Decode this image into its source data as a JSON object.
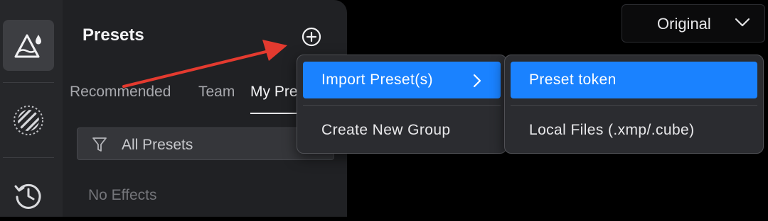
{
  "panel": {
    "title": "Presets",
    "tabs": [
      {
        "label": "Recommended",
        "selected": false
      },
      {
        "label": "Team",
        "selected": false
      },
      {
        "label": "My Presets",
        "selected": true
      }
    ],
    "filter_label": "All Presets",
    "empty_text": "No Effects"
  },
  "sort": {
    "value": "Original"
  },
  "menu": {
    "items": [
      {
        "label": "Import Preset(s)",
        "highlighted": true,
        "has_submenu": true
      },
      {
        "label": "Create New Group",
        "highlighted": false,
        "has_submenu": false
      }
    ]
  },
  "submenu": {
    "items": [
      {
        "label": "Preset token",
        "highlighted": true
      },
      {
        "label": "Local Files (.xmp/.cube)",
        "highlighted": false
      }
    ]
  },
  "colors": {
    "highlight": "#1a82ff",
    "annotation_arrow": "#e33a2f",
    "panel_bg": "#202124",
    "rail_bg": "#26272a"
  },
  "icons": {
    "rail": [
      "presets-mountain-icon",
      "texture-icon",
      "history-icon"
    ],
    "add": "plus-circle-icon",
    "filter": "funnel-icon",
    "sort": "chevron-down-icon",
    "submenu": "chevron-right-icon"
  }
}
